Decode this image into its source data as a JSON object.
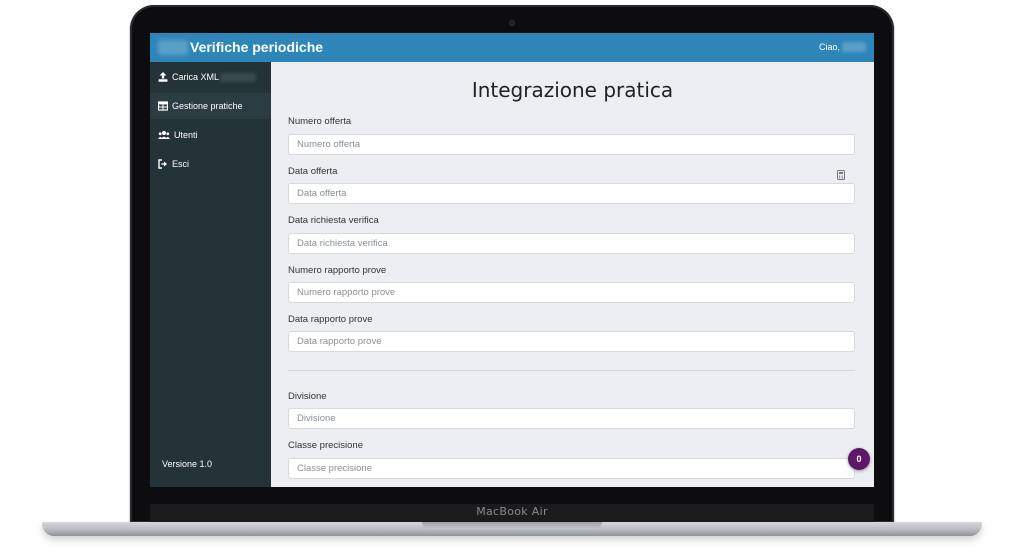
{
  "device": {
    "model_label": "MacBook Air"
  },
  "header": {
    "title": "Verifiche periodiche",
    "greeting": "Ciao,"
  },
  "sidebar": {
    "items": [
      {
        "label": "Carica XML",
        "icon": "upload-icon"
      },
      {
        "label": "Gestione pratiche",
        "icon": "table-icon"
      },
      {
        "label": "Utenti",
        "icon": "users-icon"
      },
      {
        "label": "Esci",
        "icon": "sign-out-icon"
      }
    ],
    "version": "Versione 1.0"
  },
  "main": {
    "title": "Integrazione pratica",
    "fields": [
      {
        "label": "Numero offerta",
        "placeholder": "Numero offerta"
      },
      {
        "label": "Data offerta",
        "placeholder": "Data offerta"
      },
      {
        "label": "Data richiesta verifica",
        "placeholder": "Data richiesta verifica"
      },
      {
        "label": "Numero rapporto prove",
        "placeholder": "Numero rapporto prove"
      },
      {
        "label": "Data rapporto prove",
        "placeholder": "Data rapporto prove"
      },
      {
        "label": "Divisione",
        "placeholder": "Divisione"
      },
      {
        "label": "Classe precisione",
        "placeholder": "Classe precisione"
      }
    ]
  },
  "badge": {
    "count": "0",
    "color": "#5b1966"
  },
  "colors": {
    "topbar": "#2e86b8",
    "sidebar": "#233338",
    "main_bg": "#eceef1"
  }
}
